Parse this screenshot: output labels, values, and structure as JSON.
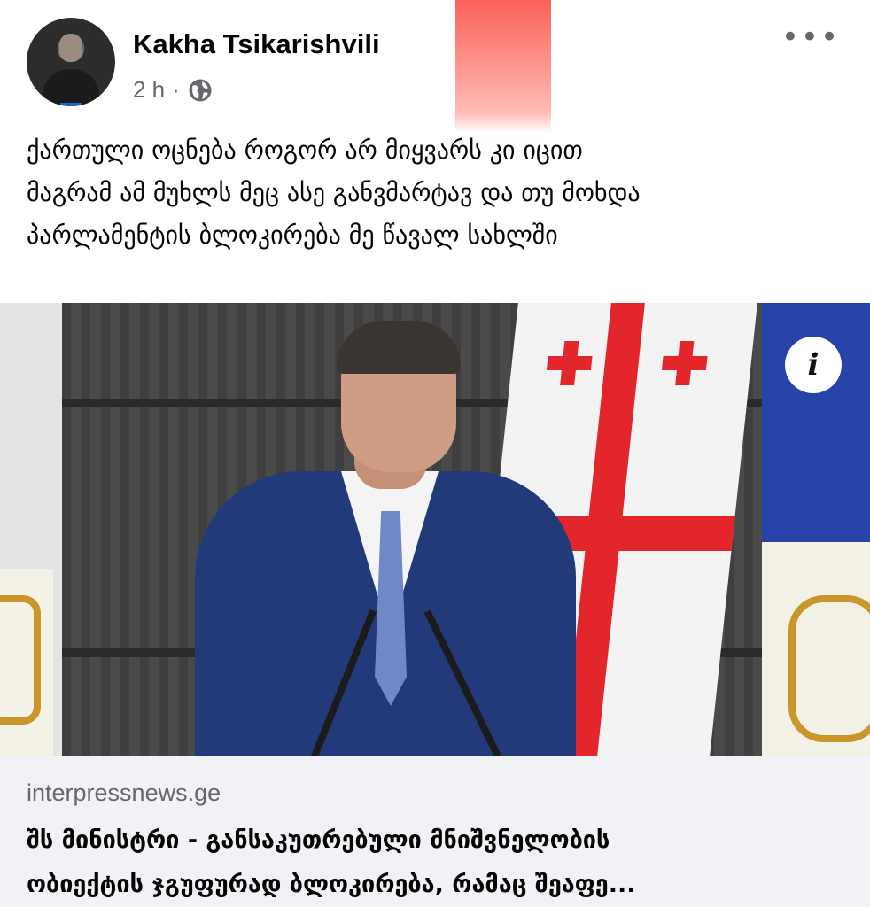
{
  "post": {
    "author": "Kakha Tsikarishvili",
    "time": "2 h",
    "separator": "·",
    "more_label": "•••",
    "text_lines": [
      "ქართული ოცნება როგორ არ მიყვარს კი იცით",
      "მაგრამ ამ მუხლს მეც ასე განვმარტავ და თუ მოხდა",
      "პარლამენტის ბლოკირება მე წავალ სახლში"
    ]
  },
  "icons": {
    "audience": "globe-icon",
    "more": "more-options-icon",
    "info": "info-icon"
  },
  "media": {
    "info_label": "i"
  },
  "link": {
    "domain": "interpressnews.ge",
    "title_lines": [
      "შს მინისტრი - განსაკუთრებული მნიშვნელობის",
      "ობიექტის ჯგუფურად ბლოკირება, რამაც შეაფე..."
    ]
  },
  "colors": {
    "secondary_text": "#65676b",
    "link_background": "#f0f2f5",
    "flag_red": "#e3262b"
  }
}
